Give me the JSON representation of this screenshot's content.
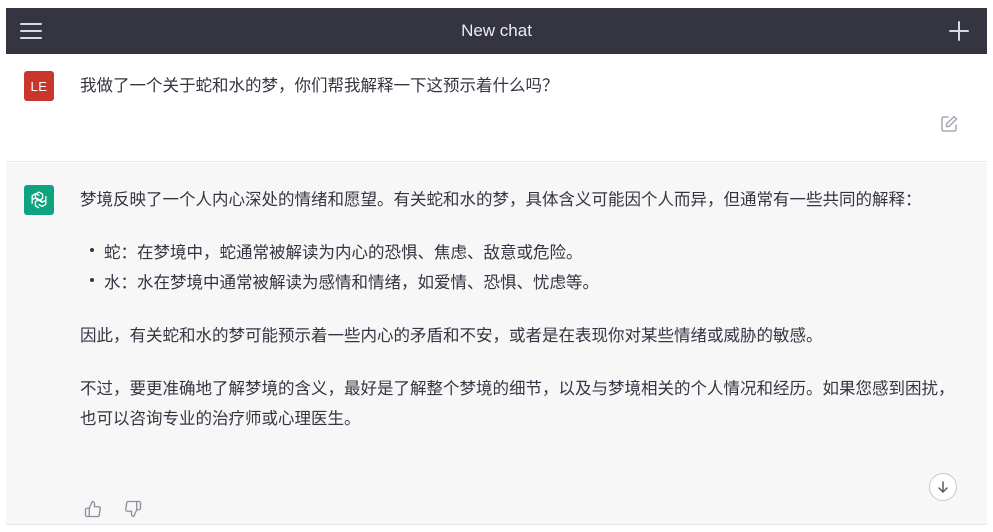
{
  "header": {
    "title": "New chat",
    "menu_icon": "hamburger-menu-icon",
    "new_chat_icon": "plus-icon"
  },
  "user_message": {
    "avatar_initials": "LE",
    "avatar_color": "#c9372c",
    "text": "我做了一个关于蛇和水的梦，你们帮我解释一下这预示着什么吗？",
    "edit_icon": "edit-icon"
  },
  "assistant_message": {
    "avatar_icon": "openai-logo-icon",
    "avatar_color": "#10a37f",
    "intro": "梦境反映了一个人内心深处的情绪和愿望。有关蛇和水的梦，具体含义可能因个人而异，但通常有一些共同的解释：",
    "bullets": [
      "蛇：在梦境中，蛇通常被解读为内心的恐惧、焦虑、敌意或危险。",
      "水：水在梦境中通常被解读为感情和情绪，如爱情、恐惧、忧虑等。"
    ],
    "paragraph2": "因此，有关蛇和水的梦可能预示着一些内心的矛盾和不安，或者是在表现你对某些情绪或威胁的敏感。",
    "paragraph3": "不过，要更准确地了解梦境的含义，最好是了解整个梦境的细节，以及与梦境相关的个人情况和经历。如果您感到困扰，也可以咨询专业的治疗师或心理医生。",
    "thumbs_up_icon": "thumbs-up-icon",
    "thumbs_down_icon": "thumbs-down-icon"
  },
  "scroll_button_icon": "arrow-down-icon",
  "colors": {
    "topbar_bg": "#343541",
    "assistant_bg": "#f7f7f8"
  }
}
